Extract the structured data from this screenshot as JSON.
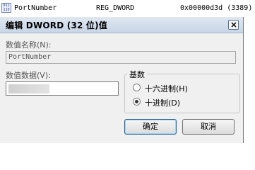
{
  "registry_row": {
    "icon_text": "011\n110",
    "name": "PortNumber",
    "type": "REG_DWORD",
    "data": "0x00000d3d (3389)"
  },
  "dialog": {
    "title": "编辑 DWORD (32 位)值",
    "value_name_label": "数值名称(N):",
    "value_name": "PortNumber",
    "value_data_label": "数值数据(V):",
    "value_data": "",
    "base_label": "基数",
    "radix_options": [
      {
        "label": "十六进制(H)",
        "checked": false
      },
      {
        "label": "十进制(D)",
        "checked": true
      }
    ],
    "ok_label": "确定",
    "cancel_label": "取消"
  }
}
